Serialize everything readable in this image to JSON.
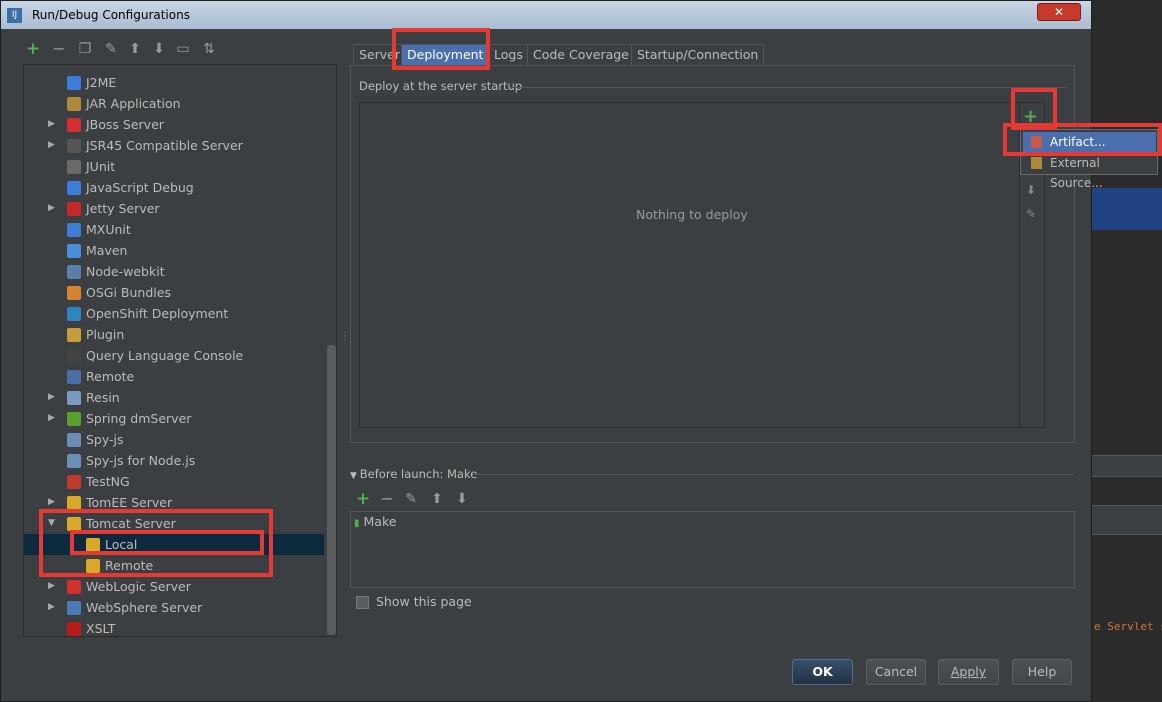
{
  "window": {
    "title": "Run/Debug Configurations",
    "close_label": "✕"
  },
  "left_toolbar": [
    "add-icon",
    "remove-icon",
    "copy-icon",
    "edit-defaults-icon",
    "move-up-icon",
    "move-down-icon",
    "folder-icon",
    "sort-icon"
  ],
  "tree": [
    {
      "label": "J2ME",
      "icon": "j2me-icon",
      "color": "#3b7dd8",
      "expand": false
    },
    {
      "label": "JAR Application",
      "icon": "jar-icon",
      "color": "#b08a3c",
      "expand": false
    },
    {
      "label": "JBoss Server",
      "icon": "jboss-icon",
      "color": "#d32f2f",
      "expand": true
    },
    {
      "label": "JSR45 Compatible Server",
      "icon": "jsr45-icon",
      "color": "#555555",
      "expand": true
    },
    {
      "label": "JUnit",
      "icon": "junit-icon",
      "color": "#6a6a6a",
      "expand": false
    },
    {
      "label": "JavaScript Debug",
      "icon": "js-debug-icon",
      "color": "#3b7dd8",
      "expand": false
    },
    {
      "label": "Jetty Server",
      "icon": "jetty-icon",
      "color": "#c62828",
      "expand": true
    },
    {
      "label": "MXUnit",
      "icon": "mxunit-icon",
      "color": "#3b7dd8",
      "expand": false
    },
    {
      "label": "Maven",
      "icon": "maven-icon",
      "color": "#4a90d9",
      "expand": false
    },
    {
      "label": "Node-webkit",
      "icon": "node-webkit-icon",
      "color": "#5a7fa8",
      "expand": false
    },
    {
      "label": "OSGi Bundles",
      "icon": "osgi-icon",
      "color": "#d4832f",
      "expand": false
    },
    {
      "label": "OpenShift Deployment",
      "icon": "openshift-icon",
      "color": "#2e86c1",
      "expand": false
    },
    {
      "label": "Plugin",
      "icon": "plugin-icon",
      "color": "#c59d3a",
      "expand": false
    },
    {
      "label": "Query Language Console",
      "icon": "ql-console-icon",
      "color": "#444444",
      "expand": false
    },
    {
      "label": "Remote",
      "icon": "remote-icon",
      "color": "#4a6fa5",
      "expand": false
    },
    {
      "label": "Resin",
      "icon": "resin-icon",
      "color": "#7a9bc0",
      "expand": true
    },
    {
      "label": "Spring dmServer",
      "icon": "spring-icon",
      "color": "#5aa02c",
      "expand": true
    },
    {
      "label": "Spy-js",
      "icon": "spy-js-icon",
      "color": "#6a8fb5",
      "expand": false
    },
    {
      "label": "Spy-js for Node.js",
      "icon": "spy-js-node-icon",
      "color": "#6a8fb5",
      "expand": false
    },
    {
      "label": "TestNG",
      "icon": "testng-icon",
      "color": "#c0392b",
      "expand": false
    },
    {
      "label": "TomEE Server",
      "icon": "tomee-icon",
      "color": "#d9a829",
      "expand": true
    },
    {
      "label": "Tomcat Server",
      "icon": "tomcat-icon",
      "color": "#d9a829",
      "expand": "open"
    },
    {
      "label": "Local",
      "icon": "tomcat-local-icon",
      "color": "#d9a829",
      "expand": "child",
      "selected": true
    },
    {
      "label": "Remote",
      "icon": "tomcat-remote-icon",
      "color": "#d9a829",
      "expand": "child"
    },
    {
      "label": "WebLogic Server",
      "icon": "weblogic-icon",
      "color": "#d32f2f",
      "expand": true
    },
    {
      "label": "WebSphere Server",
      "icon": "websphere-icon",
      "color": "#4a7ab8",
      "expand": true
    },
    {
      "label": "XSLT",
      "icon": "xslt-icon",
      "color": "#b71c1c",
      "expand": false
    }
  ],
  "tabs": [
    "Server",
    "Deployment",
    "Logs",
    "Code Coverage",
    "Startup/Connection"
  ],
  "deployment": {
    "section_label": "Deploy at the server startup",
    "empty_text": "Nothing to deploy"
  },
  "popup": {
    "items": [
      "Artifact...",
      "External Source..."
    ]
  },
  "before_launch": {
    "label": "Before launch: Make",
    "items": [
      "Make"
    ]
  },
  "show_page": "Show this page",
  "buttons": {
    "ok": "OK",
    "cancel": "Cancel",
    "apply": "Apply",
    "help": "Help"
  },
  "background_code": "e Servlet s"
}
